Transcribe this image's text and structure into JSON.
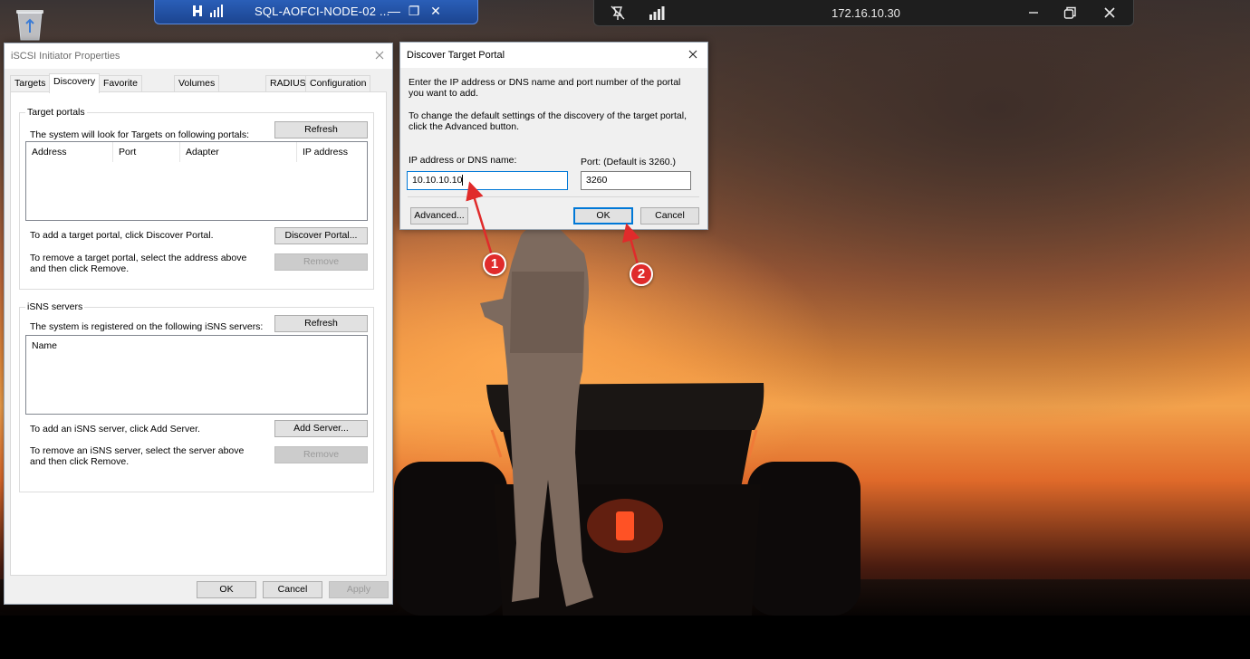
{
  "rdp_left": {
    "title": "SQL-AOFCI-NODE-02 ...",
    "minimize": "—",
    "restore": "❐",
    "close": "✕"
  },
  "rdp_right": {
    "host": "172.16.10.30"
  },
  "iscsi": {
    "title": "iSCSI Initiator Properties",
    "tabs": [
      "Targets",
      "Discovery",
      "Favorite Targets",
      "Volumes and Devices",
      "RADIUS",
      "Configuration"
    ],
    "active_tab": "Discovery",
    "target_portals": {
      "legend": "Target portals",
      "desc": "The system will look for Targets on following portals:",
      "refresh": "Refresh",
      "columns": [
        "Address",
        "Port",
        "Adapter",
        "IP address"
      ],
      "add_hint": "To add a target portal, click Discover Portal.",
      "discover_btn": "Discover Portal...",
      "remove_hint": "To remove a target portal, select the address above and then click Remove.",
      "remove_btn": "Remove"
    },
    "isns": {
      "legend": "iSNS servers",
      "desc": "The system is registered on the following iSNS servers:",
      "refresh": "Refresh",
      "columns": [
        "Name"
      ],
      "add_hint": "To add an iSNS server, click Add Server.",
      "add_btn": "Add Server...",
      "remove_hint": "To remove an iSNS server, select the server above and then click Remove.",
      "remove_btn": "Remove"
    },
    "buttons": {
      "ok": "OK",
      "cancel": "Cancel",
      "apply": "Apply"
    }
  },
  "discover": {
    "title": "Discover Target Portal",
    "intro": "Enter the IP address or DNS name and port number of the portal you want to add.",
    "advanced_hint": "To change the default settings of the discovery of the target portal, click the Advanced button.",
    "ip_label": "IP address or DNS name:",
    "ip_value": "10.10.10.10",
    "port_label": "Port: (Default is 3260.)",
    "port_value": "3260",
    "advanced_btn": "Advanced...",
    "ok_btn": "OK",
    "cancel_btn": "Cancel"
  },
  "annotations": {
    "step1": "1",
    "step2": "2",
    "color": "#e02b2b"
  }
}
